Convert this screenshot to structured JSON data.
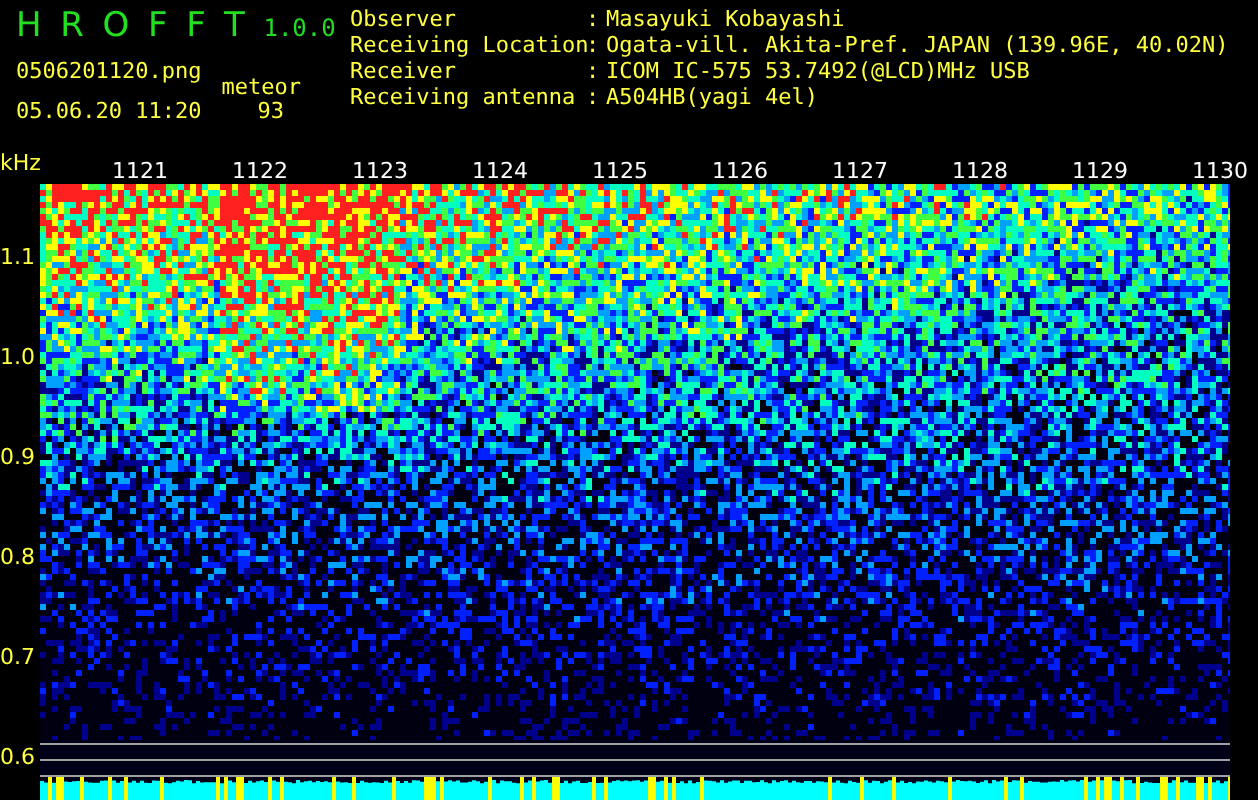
{
  "app": {
    "title": "HROFFT",
    "version": "1.0.0",
    "filename": "0506201120.png",
    "datetime": "05.06.20 11:20",
    "meteor_label": "meteor",
    "meteor_count": "93"
  },
  "info": [
    {
      "label": "Observer",
      "separator": ":",
      "value": "Masayuki Kobayashi"
    },
    {
      "label": "Receiving Location",
      "separator": ":",
      "value": "Ogata-vill. Akita-Pref. JAPAN (139.96E, 40.02N)"
    },
    {
      "label": "Receiver",
      "separator": ":",
      "value": "ICOM IC-575 53.7492(@LCD)MHz USB"
    },
    {
      "label": "Receiving antenna",
      "separator": ":",
      "value": "A504HB(yagi 4el)"
    }
  ],
  "freq_axis": {
    "unit": "kHz",
    "labels": [
      "1.1",
      "1.0",
      "0.9",
      "0.8",
      "0.7",
      "0.6"
    ]
  },
  "time_labels": [
    "1121",
    "1122",
    "1123",
    "1124",
    "1125",
    "1126",
    "1127",
    "1128",
    "1129",
    "1130"
  ]
}
